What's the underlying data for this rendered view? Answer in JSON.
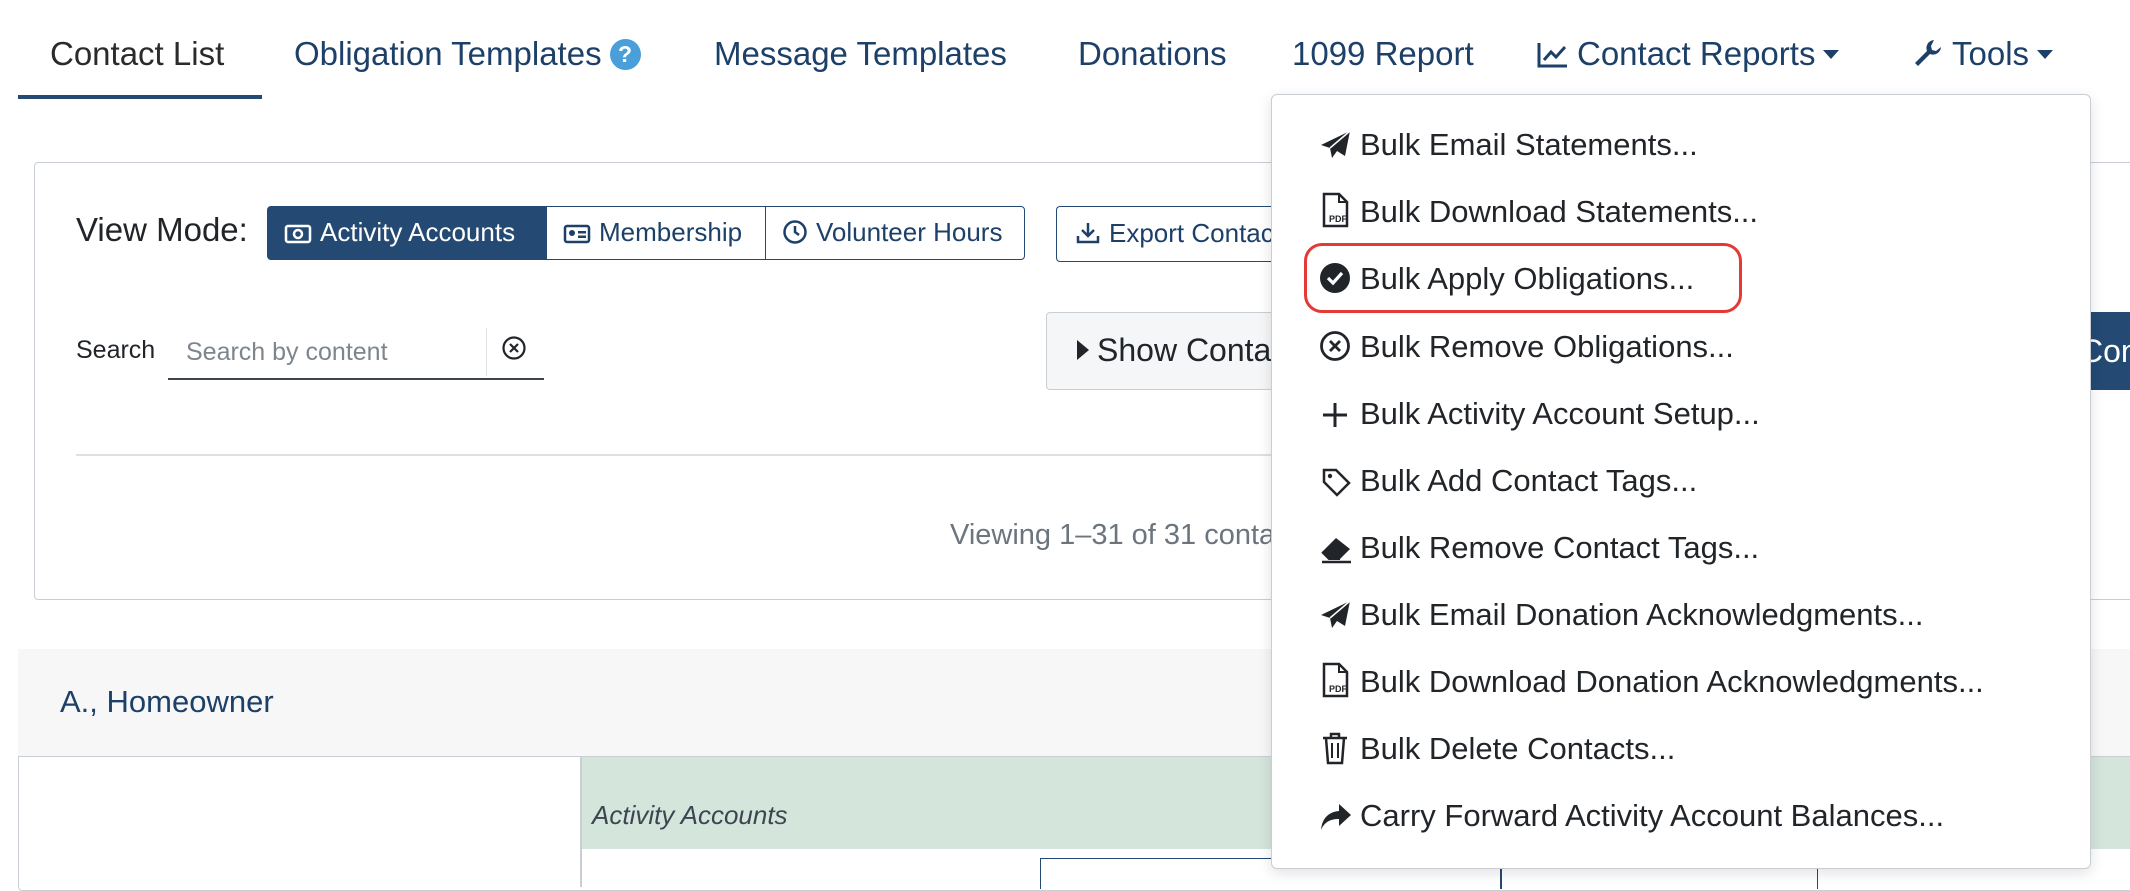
{
  "nav": {
    "tabs": [
      {
        "label": "Contact List"
      },
      {
        "label": "Obligation Templates",
        "help": "?"
      },
      {
        "label": "Message Templates"
      },
      {
        "label": "Donations"
      },
      {
        "label": "1099 Report"
      },
      {
        "label": "Contact Reports"
      },
      {
        "label": "Tools"
      }
    ],
    "active_tab": "Contact List"
  },
  "view_mode": {
    "label": "View Mode:",
    "options": [
      "Activity Accounts",
      "Membership",
      "Volunteer Hours"
    ],
    "selected": "Activity Accounts"
  },
  "export_button": "Export Contac",
  "search": {
    "label": "Search",
    "placeholder": "Search by content"
  },
  "show_button": "Show Conta",
  "right_button": "Con",
  "viewing_text": "Viewing 1–31 of 31 conta",
  "contact_card": {
    "name": "A., Homeowner",
    "section_label": "Activity Accounts"
  },
  "tools_menu": {
    "items": [
      {
        "label": "Bulk Email Statements...",
        "icon": "paper-plane-icon"
      },
      {
        "label": "Bulk Download Statements...",
        "icon": "pdf-file-icon"
      },
      {
        "label": "Bulk Apply Obligations...",
        "icon": "check-circle-icon",
        "highlighted": true
      },
      {
        "label": "Bulk Remove Obligations...",
        "icon": "x-circle-icon"
      },
      {
        "label": "Bulk Activity Account Setup...",
        "icon": "plus-icon"
      },
      {
        "label": "Bulk Add Contact Tags...",
        "icon": "tag-icon"
      },
      {
        "label": "Bulk Remove Contact Tags...",
        "icon": "eraser-icon"
      },
      {
        "label": "Bulk Email Donation Acknowledgments...",
        "icon": "paper-plane-icon"
      },
      {
        "label": "Bulk Download Donation Acknowledgments...",
        "icon": "pdf-file-icon"
      },
      {
        "label": "Bulk Delete Contacts...",
        "icon": "trash-icon"
      },
      {
        "label": "Carry Forward Activity Account Balances...",
        "icon": "share-arrow-icon"
      }
    ]
  },
  "colors": {
    "navy": "#244a73",
    "link": "#1d4068",
    "highlight": "#e53935",
    "strip": "#d4e5dc"
  }
}
